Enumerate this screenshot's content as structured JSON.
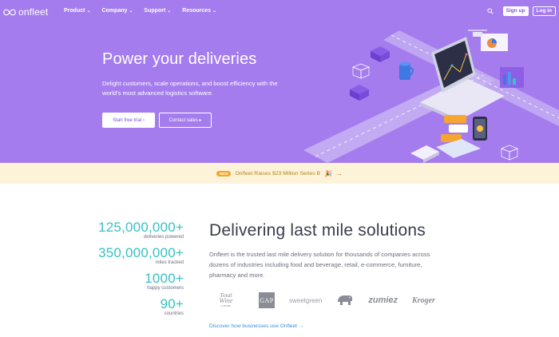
{
  "nav": {
    "logo_text": "onfleet",
    "menu": [
      "Product",
      "Company",
      "Support",
      "Resources"
    ],
    "signup": "Sign up",
    "login": "Log in"
  },
  "hero": {
    "title": "Power your deliveries",
    "subtitle": "Delight customers, scale operations, and boost efficiency with the world's most advanced logistics software.",
    "trial_button": "Start free trial ›",
    "contact_button": "Contact sales ▸"
  },
  "banner": {
    "badge": "NEW",
    "text": "Onfleet Raises $23 Million Series B",
    "emoji": "🎉",
    "arrow": "→"
  },
  "stats": [
    {
      "value": "125,000,000+",
      "label": "deliveries powered"
    },
    {
      "value": "350,000,000+",
      "label": "miles tracked"
    },
    {
      "value": "1000+",
      "label": "happy customers"
    },
    {
      "value": "90+",
      "label": "countries"
    }
  ],
  "main": {
    "title": "Delivering last mile solutions",
    "paragraph": "Onfleet is the trusted last mile delivery solution for thousands of companies across dozens of industries including food and beverage, retail, e-commerce, furniture, pharmacy and more.",
    "discover_link": "Discover how businesses use Onfleet →"
  },
  "brands": [
    "Total Wine",
    "GAP",
    "sweetgreen",
    "Bear logo",
    "zumiez",
    "Kroger"
  ],
  "brand_text": {
    "total_wine_line1": "Total",
    "total_wine_line2": "Wine",
    "total_wine_sub": "& MORE",
    "gap": "GAP",
    "sweetgreen": "sweetgreen",
    "zumiez": "zumiez",
    "kroger": "Kroger"
  },
  "colors": {
    "hero_bg": "#a57cee",
    "accent_teal": "#39c0c4",
    "banner_bg": "#fdf3d9",
    "link": "#3d8fd6"
  }
}
